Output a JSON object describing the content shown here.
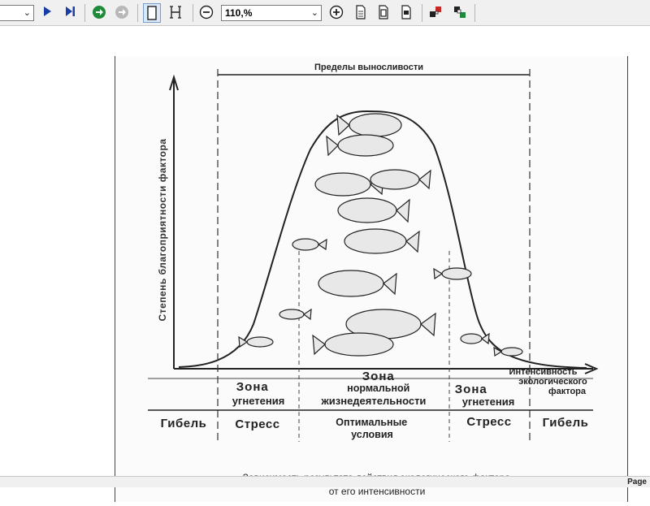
{
  "toolbar": {
    "zoom_value": "110,%"
  },
  "figure": {
    "endurance_title": "Пределы выносливости",
    "ylabel": "Степень благоприятности фактора",
    "xlabel_lines": [
      "Интенсивность",
      "экологического",
      "фактора"
    ],
    "zone_left": [
      "Зона",
      "угнетения"
    ],
    "zone_center": [
      "Зона",
      "нормальной",
      "жизнедеятельности"
    ],
    "zone_right": [
      "Зона",
      "угнетения"
    ],
    "row_death_left": "Гибель",
    "row_stress_left": "Стресс",
    "row_optimal": [
      "Оптимальные",
      "условия"
    ],
    "row_stress_right": "Стресс",
    "row_death_right": "Гибель",
    "caption_lines": [
      "Зависимость результата действия экологического фактора",
      "от его интенсивности"
    ]
  },
  "status": {
    "text": "Page"
  },
  "colors": {
    "toolbar_bg": "#f0f0f0",
    "play_icon": "#1a3ea8",
    "nav_green": "#1f8a3a",
    "ink": "#222222"
  }
}
